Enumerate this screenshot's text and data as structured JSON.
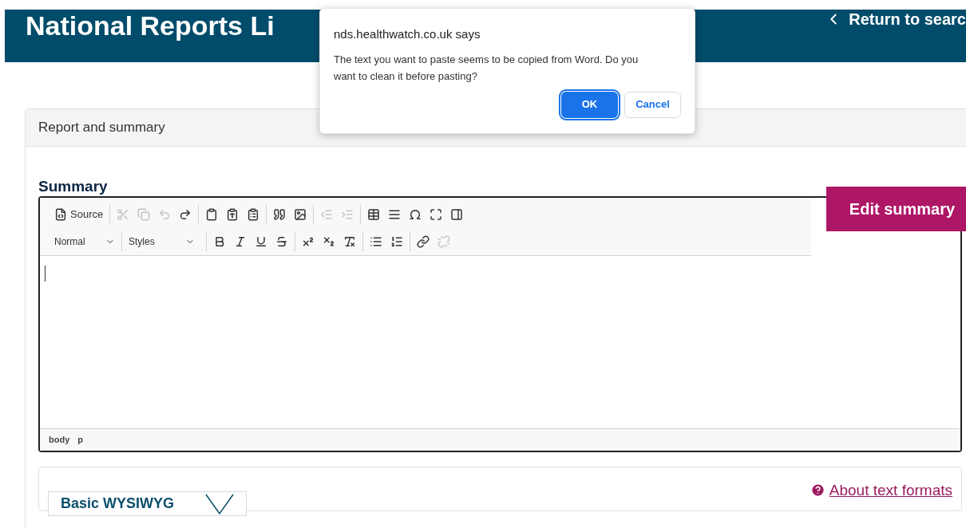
{
  "header": {
    "title": "National Reports Li",
    "back_link": "Return to searc"
  },
  "dialog": {
    "origin": "nds.healthwatch.co.uk says",
    "message": "The text you want to paste seems to be copied from Word. Do you want to clean it before pasting?",
    "buttons": [
      {
        "label": "OK",
        "primary": true
      },
      {
        "label": "Cancel",
        "primary": false
      }
    ]
  },
  "panel": {
    "title": "Report and summary"
  },
  "summary": {
    "heading": "Summary",
    "edit_button": "Edit summary",
    "toolbar_row_1": [
      [
        {
          "label": "Source",
          "disabled": false
        }
      ],
      [
        {
          "disabled": true
        },
        {
          "disabled": true
        },
        {
          "disabled": true
        },
        {
          "disabled": false
        }
      ],
      [
        {
          "disabled": false
        },
        {
          "disabled": false
        },
        {
          "disabled": false
        }
      ],
      [
        {
          "disabled": false
        },
        {
          "disabled": false
        }
      ],
      [
        {
          "disabled": true
        },
        {
          "disabled": true
        }
      ],
      [
        {
          "disabled": false
        },
        {
          "disabled": false
        },
        {
          "disabled": false
        },
        {
          "disabled": false
        },
        {
          "disabled": false
        }
      ]
    ],
    "format_dropdown": "Normal",
    "styles_dropdown": "Styles",
    "toolbar_row_2": [
      [
        {
          "disabled": false
        },
        {
          "disabled": false
        },
        {
          "disabled": false
        },
        {
          "disabled": false
        }
      ],
      [
        {
          "disabled": false
        },
        {
          "disabled": false
        },
        {
          "disabled": false
        }
      ],
      [
        {
          "disabled": false
        },
        {
          "disabled": false
        }
      ],
      [
        {
          "disabled": false
        },
        {
          "disabled": true
        }
      ]
    ],
    "path": [
      "body",
      "p"
    ]
  },
  "text_format": {
    "select": "Basic WYSIWYG",
    "help_link": "About text formats"
  }
}
